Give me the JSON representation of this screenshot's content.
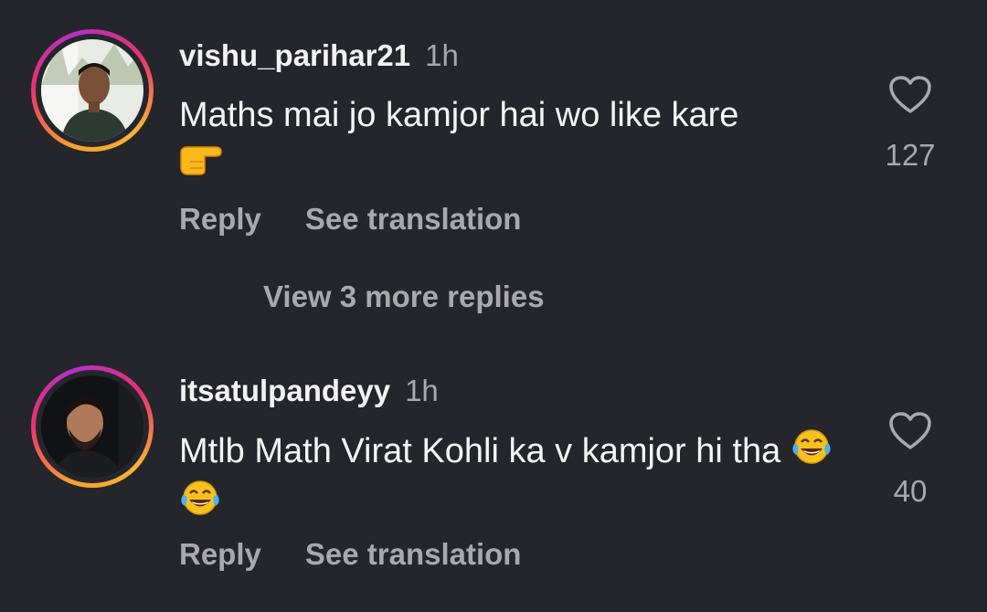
{
  "comments": [
    {
      "username": "vishu_parihar21",
      "time": "1h",
      "text": "Maths mai jo kamjor hai wo like kare",
      "emoji": "backhand-index-pointing-right",
      "likes": "127",
      "reply_label": "Reply",
      "translate_label": "See translation"
    },
    {
      "username": "itsatulpandeyy",
      "time": "1h",
      "text": "Mtlb Math Virat Kohli ka v kamjor hi tha",
      "emoji": "face-with-tears-of-joy x2",
      "likes": "40",
      "reply_label": "Reply",
      "translate_label": "See translation"
    }
  ],
  "view_more_label": "View 3 more replies",
  "colors": {
    "background": "#25262b",
    "primary_text": "#f2f2f2",
    "secondary_text": "#a8a8ad",
    "story_ring": [
      "#f9a12d",
      "#e8336b",
      "#b32fc7"
    ]
  }
}
